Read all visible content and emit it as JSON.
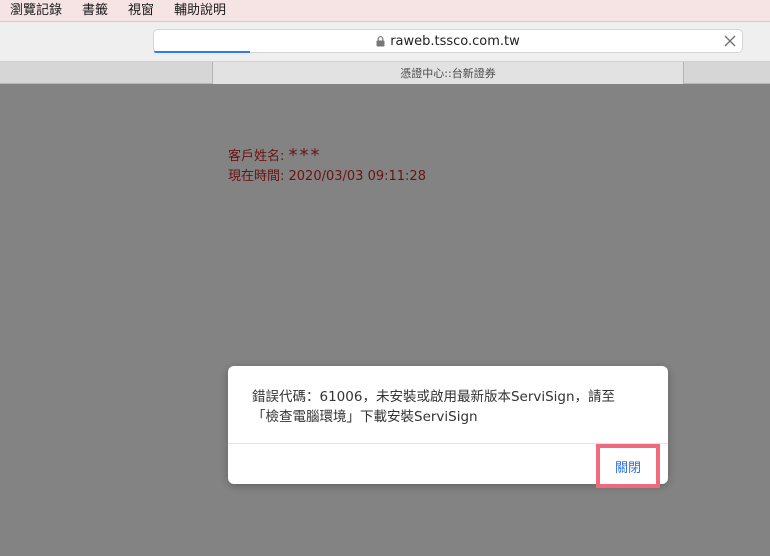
{
  "menubar": {
    "items": [
      "瀏覽記錄",
      "書籤",
      "視窗",
      "輔助說明"
    ]
  },
  "toolbar": {
    "url": "raweb.tssco.com.tw"
  },
  "tab": {
    "title": "憑證中心::台新證券"
  },
  "info": {
    "customer_label": "客戶姓名: ",
    "customer_value": "***",
    "time_label": "現在時間: ",
    "time_value": "2020/03/03 09:11:28"
  },
  "dialog": {
    "message_line1": "錯誤代碼：61006，未安裝或啟用最新版本ServiSign，請至",
    "message_line2": "「檢查電腦環境」下載安裝ServiSign",
    "close_label": "關閉"
  },
  "colors": {
    "page_background": "#828382",
    "info_text": "#6b1313",
    "link_blue": "#2f6fe0",
    "highlight_border": "#ef6a7e"
  }
}
